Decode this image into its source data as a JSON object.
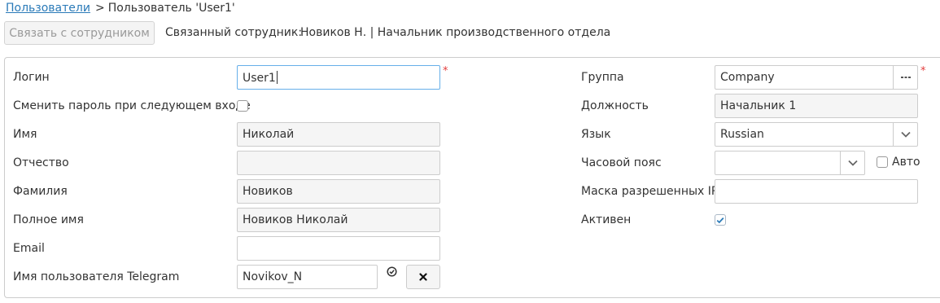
{
  "breadcrumb": {
    "parent": "Пользователи",
    "separator": ">",
    "current": "Пользователь 'User1'"
  },
  "toolbar": {
    "link_employee_label": "Связать с сотрудником",
    "linked_employee_label": "Связанный сотрудник:",
    "linked_employee_value": "Новиков Н. | Начальник производственного отдела"
  },
  "form": {
    "login": {
      "label": "Логин",
      "value": "User1",
      "required": "*"
    },
    "change_password": {
      "label": "Сменить пароль при следующем входе",
      "checked": false
    },
    "first_name": {
      "label": "Имя",
      "value": "Николай"
    },
    "middle_name": {
      "label": "Отчество",
      "value": ""
    },
    "last_name": {
      "label": "Фамилия",
      "value": "Новиков"
    },
    "full_name": {
      "label": "Полное имя",
      "value": "Новиков Николай"
    },
    "email": {
      "label": "Email",
      "value": ""
    },
    "telegram": {
      "label": "Имя пользователя Telegram",
      "value": "Novikov_N"
    },
    "group": {
      "label": "Группа",
      "value": "Company",
      "required": "*"
    },
    "position": {
      "label": "Должность",
      "value": "Начальник 1"
    },
    "language": {
      "label": "Язык",
      "value": "Russian"
    },
    "timezone": {
      "label": "Часовой пояс",
      "value": "",
      "auto_label": "Авто",
      "auto_checked": false
    },
    "ip_mask": {
      "label": "Маска разрешенных IP",
      "value": ""
    },
    "active": {
      "label": "Активен",
      "checked": true
    }
  },
  "icons": {
    "group_picker": "ellipsis-icon",
    "dropdown": "chevron-down-icon",
    "telegram_status": "check-circle-icon",
    "telegram_clear": "close-icon"
  },
  "colors": {
    "link": "#2a7ab8",
    "required": "#e23c3c",
    "focus_border": "#66afe9",
    "disabled_text": "#9a9a9a"
  }
}
